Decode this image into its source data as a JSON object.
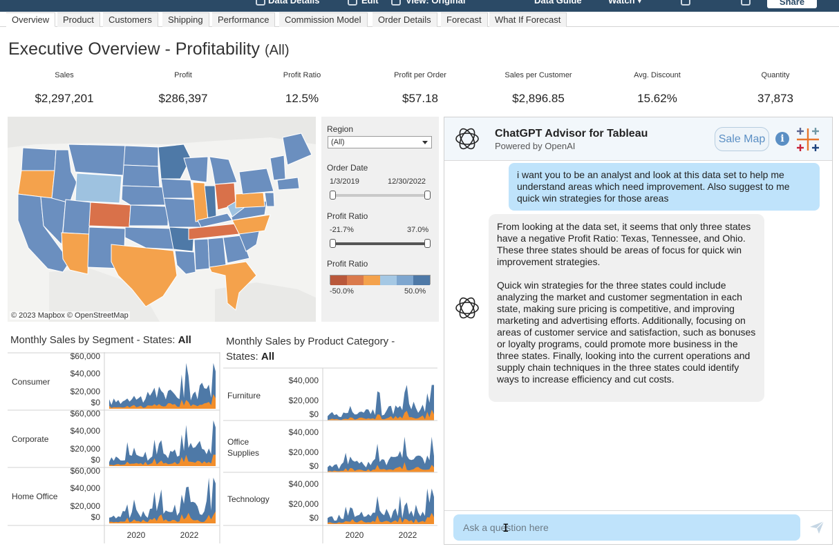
{
  "toolbar": {
    "items": [
      "Data Details",
      "Edit",
      "View: Original",
      "Data Guide",
      "Watch ▾"
    ],
    "share_label": "Share"
  },
  "tabs": [
    "Overview",
    "Product",
    "Customers",
    "Shipping",
    "Performance",
    "Commission Model",
    "Order Details",
    "Forecast",
    "What If Forecast"
  ],
  "active_tab": "Overview",
  "header": {
    "title": "Executive Overview - Profitability",
    "filter": "(All)"
  },
  "kpis": [
    {
      "label": "Sales",
      "value": "$2,297,201"
    },
    {
      "label": "Profit",
      "value": "$286,397"
    },
    {
      "label": "Profit Ratio",
      "value": "12.5%"
    },
    {
      "label": "Profit per Order",
      "value": "$57.18"
    },
    {
      "label": "Sales per Customer",
      "value": "$2,896.85"
    },
    {
      "label": "Avg. Discount",
      "value": "15.62%"
    },
    {
      "label": "Quantity",
      "value": "37,873"
    }
  ],
  "map": {
    "attribution": "© 2023 Mapbox  © OpenStreetMap",
    "colors": {
      "dark_blue": "#4e79a7",
      "mid_blue": "#6b8fbf",
      "light_blue": "#9ec2e0",
      "orange": "#f4a24c",
      "dark_orange": "#d9714a"
    }
  },
  "filters": {
    "region_label": "Region",
    "region_value": "(All)",
    "order_date_label": "Order Date",
    "order_date_min": "1/3/2019",
    "order_date_max": "12/30/2022",
    "profit_ratio_label": "Profit Ratio",
    "profit_ratio_min": "-21.7%",
    "profit_ratio_max": "37.0%",
    "legend_label": "Profit Ratio",
    "legend_min": "-50.0%",
    "legend_max": "50.0%",
    "legend_colors": [
      "#b9583b",
      "#da7a4c",
      "#f4a24c",
      "#a5c8e4",
      "#7ea6cf",
      "#4e79a7"
    ]
  },
  "segment_chart": {
    "title_prefix": "Monthly Sales by Segment - States: ",
    "title_value": "All",
    "rows": [
      "Consumer",
      "Corporate",
      "Home Office"
    ],
    "y_ticks": [
      "$60,000",
      "$40,000",
      "$20,000",
      "$0"
    ],
    "x_ticks": [
      "2020",
      "2022"
    ]
  },
  "category_chart": {
    "title_prefix": "Monthly Sales by Product Category - States: ",
    "title_value": "All",
    "rows": [
      "Furniture",
      "Office Supplies",
      "Technology"
    ],
    "y_ticks": [
      "$40,000",
      "$20,000",
      "$0"
    ],
    "x_ticks": [
      "2020",
      "2022"
    ]
  },
  "chat": {
    "title": "ChatGPT Advisor for Tableau",
    "subtitle": "Powered by OpenAI",
    "sale_map_label": "Sale Map",
    "info_glyph": "i",
    "user_message": "i want you to be an analyst and look at this data set to help me understand areas which need improvement. Also suggest to me quick win strategies for those areas",
    "bot_message_p1": "From looking at the data set, it seems that only three states have a negative Profit Ratio: Texas, Tennessee, and Ohio. These three states should be areas of focus for quick win improvement strategies.",
    "bot_message_p2": "Quick win strategies for the three states could include analyzing the market and customer segmentation in each state, making sure pricing is competitive, and improving marketing and advertising efforts. Additionally, focusing on areas of customer service and satisfaction, such as bonuses or loyalty programs, could promote more business in the three states. Finally, looking into the current operations and supply chain techniques in the three states could identify ways to increase efficiency and cut costs.",
    "input_placeholder": "Ask a question here"
  },
  "colors": {
    "series_blue": "#4e79a7",
    "series_orange": "#f28e2b",
    "accent": "#5b8fc4"
  }
}
